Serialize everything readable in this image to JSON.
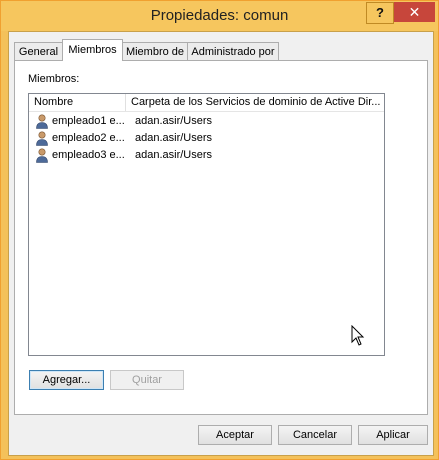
{
  "window": {
    "title": "Propiedades: comun",
    "help": "?",
    "close": "✕"
  },
  "tabs": [
    {
      "label": "General",
      "active": false
    },
    {
      "label": "Miembros",
      "active": true
    },
    {
      "label": "Miembro de",
      "active": false
    },
    {
      "label": "Administrado por",
      "active": false
    }
  ],
  "members": {
    "label": "Miembros:",
    "columns": [
      "Nombre",
      "Carpeta de los Servicios de dominio de Active Dir..."
    ],
    "rows": [
      {
        "name": "empleado1 e...",
        "folder": "adan.asir/Users"
      },
      {
        "name": "empleado2 e...",
        "folder": "adan.asir/Users"
      },
      {
        "name": "empleado3 e...",
        "folder": "adan.asir/Users"
      }
    ],
    "add": "Agregar...",
    "remove": "Quitar"
  },
  "footer": {
    "ok": "Aceptar",
    "cancel": "Cancelar",
    "apply": "Aplicar"
  },
  "icons": {
    "user": "user-icon",
    "cursor": "mouse-pointer-icon"
  },
  "colors": {
    "titlebar": "#f6c65e",
    "close": "#c7463b"
  }
}
